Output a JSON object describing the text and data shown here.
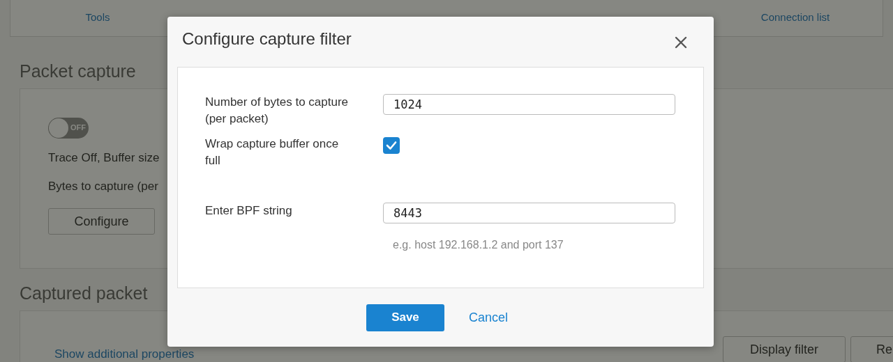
{
  "tabs": [
    {
      "label": "Tools",
      "selected": false
    },
    {
      "label": "Connection list",
      "selected": false
    }
  ],
  "packet_capture": {
    "heading": "Packet capture",
    "toggle": {
      "on": false,
      "label": "OFF"
    },
    "status_lines": [
      "Trace Off, Buffer size",
      "Bytes to capture (per"
    ],
    "configure_button": "Configure"
  },
  "captured_packet": {
    "heading": "Captured packet",
    "link": "Show additional properties",
    "buttons": [
      "Display filter",
      "Re"
    ]
  },
  "dialog": {
    "title": "Configure capture filter",
    "fields": [
      {
        "kind": "input",
        "label": "Number of bytes to capture (per packet)",
        "value": "1024"
      },
      {
        "kind": "checkbox",
        "label": "Wrap capture buffer once full",
        "checked": true
      },
      {
        "kind": "input",
        "label": "Enter BPF string",
        "value": "8443",
        "hint": "e.g. host 192.168.1.2 and port 137"
      }
    ],
    "save_button": "Save",
    "cancel_link": "Cancel"
  }
}
